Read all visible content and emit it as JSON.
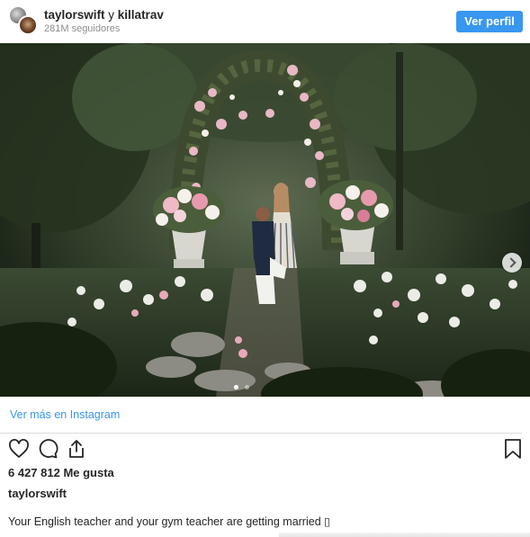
{
  "header": {
    "user1": "taylorswift",
    "conjunction": "y",
    "user2": "killatrav",
    "followers": "281M seguidores",
    "view_profile_label": "Ver perfil"
  },
  "photo": {
    "carousel_total": 2,
    "carousel_active": 1
  },
  "footer": {
    "see_more_label": "Ver más en Instagram",
    "likes": "6 427 812 Me gusta",
    "owner": "taylorswift",
    "caption": "Your English teacher and your gym teacher are getting married ▯"
  },
  "icons": {
    "like": "heart-icon",
    "comment": "comment-icon",
    "share": "share-icon",
    "save": "bookmark-icon",
    "next": "chevron-right-icon"
  },
  "colors": {
    "accent": "#3897f0",
    "text": "#262626",
    "muted": "#8e8e8e"
  }
}
